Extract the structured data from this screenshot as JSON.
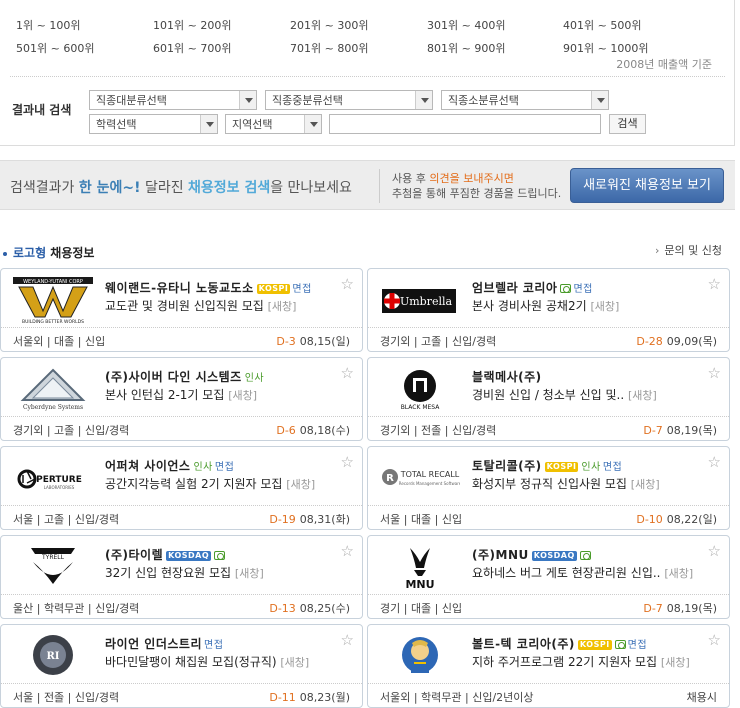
{
  "rank_links": [
    [
      "1위 ~ 100위",
      "101위 ~ 200위",
      "201위 ~ 300위",
      "301위 ~ 400위",
      "401위 ~ 500위"
    ],
    [
      "501위 ~ 600위",
      "601위 ~ 700위",
      "701위 ~ 800위",
      "801위 ~ 900위",
      "901위 ~ 1000위"
    ]
  ],
  "rank_note": "2008년 매출액 기준",
  "filter": {
    "label": "결과내 검색",
    "sel1": "직종대분류선택",
    "sel2": "직종중분류선택",
    "sel3": "직종소분류선택",
    "sel4": "학력선택",
    "sel5": "지역선택",
    "search_btn": "검색"
  },
  "banner": {
    "part1": "검색결과가 ",
    "hl1": "한 눈에~!",
    "part2": " 달라진 ",
    "hl2": "채용정보 검색",
    "part3": "을 만나보세요",
    "sub1a": "사용 후 ",
    "sub1b": "의견을 보내주시면",
    "sub2": "추첨을 통해 푸짐한 경품을 드립니다.",
    "button": "새로워진 채용정보 보기"
  },
  "section": {
    "title_blue": "로고형",
    "title_rest": " 채용정보",
    "link": "문의 및 신청"
  },
  "cards": [
    {
      "company": "웨이랜드-유타니 노동교도소",
      "kospi": true,
      "kosdaq": false,
      "insa": false,
      "interview": true,
      "camera": false,
      "job": "교도관 및 경비원 신입직원 모집",
      "new": "[새창]",
      "meta": "서울외 | 대졸 | 신입",
      "dday": "D-3",
      "date": "08,15(일)",
      "logo": "weyland"
    },
    {
      "company": "엄브렐라 코리아",
      "kospi": false,
      "kosdaq": false,
      "insa": false,
      "interview": true,
      "camera": true,
      "job": "본사 경비사원 공채2기",
      "new": "[새창]",
      "meta": "경기외 | 고졸 | 신입/경력",
      "dday": "D-28",
      "date": "09,09(목)",
      "logo": "umbrella"
    },
    {
      "company": "(주)사이버 다인 시스템즈",
      "kospi": false,
      "kosdaq": false,
      "insa": true,
      "interview": false,
      "camera": false,
      "job": "본사 인턴십 2-1기 모집",
      "new": "[새창]",
      "meta": "경기외 | 고졸 | 신입/경력",
      "dday": "D-6",
      "date": "08,18(수)",
      "logo": "cyberdyne"
    },
    {
      "company": "블랙메사(주)",
      "kospi": false,
      "kosdaq": false,
      "insa": false,
      "interview": false,
      "camera": false,
      "job": "경비원 신입 / 청소부 신입 및..",
      "new": "[새창]",
      "meta": "경기외 | 전졸 | 신입/경력",
      "dday": "D-7",
      "date": "08,19(목)",
      "logo": "blackmesa"
    },
    {
      "company": "어퍼쳐 사이언스",
      "kospi": false,
      "kosdaq": false,
      "insa": true,
      "interview": true,
      "camera": false,
      "job": "공간지각능력 실험 2기 지원자 모집",
      "new": "[새창]",
      "meta": "서울 | 고졸 | 신입/경력",
      "dday": "D-19",
      "date": "08,31(화)",
      "logo": "aperture"
    },
    {
      "company": "토탈리콜(주)",
      "kospi": true,
      "kosdaq": false,
      "insa": true,
      "interview": true,
      "camera": false,
      "job": "화성지부 정규직 신입사원 모집",
      "new": "[새창]",
      "meta": "서울 | 대졸 | 신입",
      "dday": "D-10",
      "date": "08,22(일)",
      "logo": "totalrecall"
    },
    {
      "company": "(주)타이렐",
      "kospi": false,
      "kosdaq": true,
      "insa": false,
      "interview": false,
      "camera": true,
      "job": "32기 신입 현장요원 모집",
      "new": "[새창]",
      "meta": "울산 | 학력무관 | 신입/경력",
      "dday": "D-13",
      "date": "08,25(수)",
      "logo": "tyrell"
    },
    {
      "company": "(주)MNU",
      "kospi": false,
      "kosdaq": true,
      "insa": false,
      "interview": false,
      "camera": true,
      "job": "요하네스 버그 게토 현장관리원 신입..",
      "new": "[새창]",
      "meta": "경기 | 대졸 | 신입",
      "dday": "D-7",
      "date": "08,19(목)",
      "logo": "mnu"
    },
    {
      "company": "라이언 인더스트리",
      "kospi": false,
      "kosdaq": false,
      "insa": false,
      "interview": true,
      "camera": false,
      "job": "바다민달팽이 채집원 모집(정규직)",
      "new": "[새창]",
      "meta": "서울 | 전졸 | 신입/경력",
      "dday": "D-11",
      "date": "08,23(월)",
      "logo": "ryan"
    },
    {
      "company": "볼트-텍 코리아(주)",
      "kospi": true,
      "kosdaq": false,
      "insa": false,
      "interview": true,
      "camera": true,
      "job": "지하 주거프로그램 22기 지원자 모집",
      "new": "[새창]",
      "meta": "서울외 | 학력무관 | 신입/2년이상",
      "dday": "",
      "date": "채용시",
      "logo": "vaulttec"
    }
  ]
}
